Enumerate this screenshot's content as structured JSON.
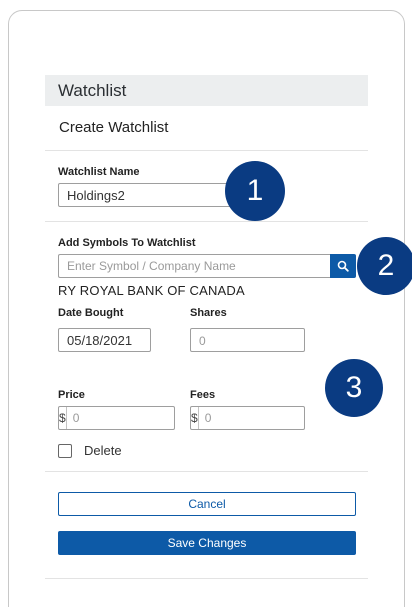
{
  "watchlist": {
    "header_title": "Watchlist",
    "subtitle": "Create Watchlist",
    "name_label": "Watchlist Name",
    "name_value": "Holdings2",
    "add_symbols_label": "Add Symbols To Watchlist",
    "symbol_placeholder": "Enter Symbol / Company Name",
    "company_name": "RY ROYAL BANK OF CANADA",
    "date_bought_label": "Date Bought",
    "date_bought_value": "05/18/2021",
    "shares_label": "Shares",
    "shares_placeholder": "0",
    "price_label": "Price",
    "price_prefix": "$",
    "price_placeholder": "0",
    "fees_label": "Fees",
    "fees_prefix": "$",
    "fees_placeholder": "0",
    "delete_label": "Delete",
    "cancel_label": "Cancel",
    "save_label": "Save Changes"
  },
  "annotations": {
    "step1": "1",
    "step2": "2",
    "step3": "3"
  },
  "icons": {
    "search": "search-icon"
  },
  "colors": {
    "primary": "#0d5aa7",
    "badge": "#0a3b82",
    "header_bg": "#eceeef"
  }
}
